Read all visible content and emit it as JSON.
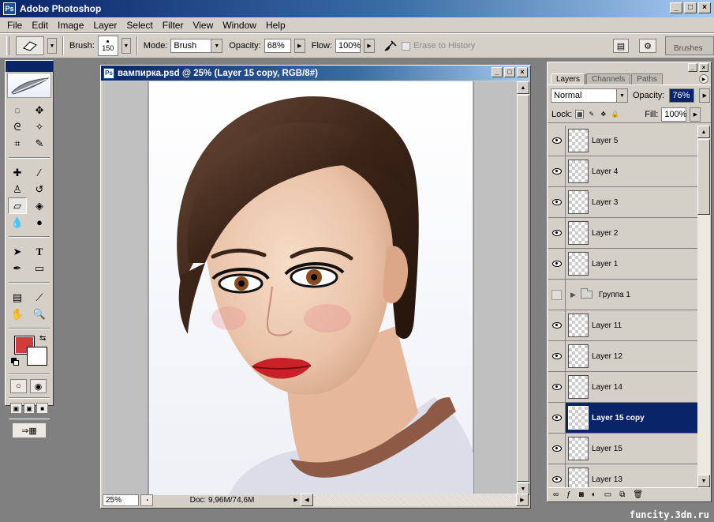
{
  "app": {
    "title": "Adobe Photoshop"
  },
  "menu": [
    "File",
    "Edit",
    "Image",
    "Layer",
    "Select",
    "Filter",
    "View",
    "Window",
    "Help"
  ],
  "options": {
    "brush_label": "Brush:",
    "brush_size": "150",
    "mode_label": "Mode:",
    "mode_value": "Brush",
    "opacity_label": "Opacity:",
    "opacity_value": "68%",
    "flow_label": "Flow:",
    "flow_value": "100%",
    "erase_history_label": "Erase to History",
    "brushes_well": "Brushes"
  },
  "toolbox": {
    "tools": [
      "marquee-icon",
      "move-icon",
      "lasso-icon",
      "magic-wand-icon",
      "crop-icon",
      "slice-icon",
      "healing-brush-icon",
      "brush-icon",
      "clone-stamp-icon",
      "history-brush-icon",
      "eraser-icon",
      "paint-bucket-icon",
      "blur-icon",
      "dodge-icon",
      "path-selection-icon",
      "type-icon",
      "pen-icon",
      "rectangle-icon",
      "notes-icon",
      "eyedropper-icon",
      "hand-icon",
      "zoom-icon"
    ],
    "foreground_color": "#d03c3c",
    "background_color": "#ffffff"
  },
  "document": {
    "title": "вампирка.psd @ 25% (Layer 15 copy, RGB/8#)",
    "zoom": "25%",
    "doc_info": "Doc: 9,96M/74,6M"
  },
  "layers_panel": {
    "tabs": [
      "Layers",
      "Channels",
      "Paths"
    ],
    "blend_mode": "Normal",
    "opacity_label": "Opacity:",
    "opacity_value": "76%",
    "lock_label": "Lock:",
    "fill_label": "Fill:",
    "fill_value": "100%",
    "layers": [
      {
        "name": "Layer 5",
        "visible": true,
        "type": "layer"
      },
      {
        "name": "Layer 4",
        "visible": true,
        "type": "layer"
      },
      {
        "name": "Layer 3",
        "visible": true,
        "type": "layer"
      },
      {
        "name": "Layer 2",
        "visible": true,
        "type": "layer"
      },
      {
        "name": "Layer 1",
        "visible": true,
        "type": "layer"
      },
      {
        "name": "Группа 1",
        "visible": false,
        "type": "group"
      },
      {
        "name": "Layer 11",
        "visible": true,
        "type": "layer"
      },
      {
        "name": "Layer 12",
        "visible": true,
        "type": "layer"
      },
      {
        "name": "Layer 14",
        "visible": true,
        "type": "layer"
      },
      {
        "name": "Layer 15 copy",
        "visible": true,
        "type": "layer",
        "selected": true
      },
      {
        "name": "Layer 15",
        "visible": true,
        "type": "layer"
      },
      {
        "name": "Layer 13",
        "visible": true,
        "type": "layer"
      }
    ]
  },
  "watermark": "funcity.3dn.ru"
}
